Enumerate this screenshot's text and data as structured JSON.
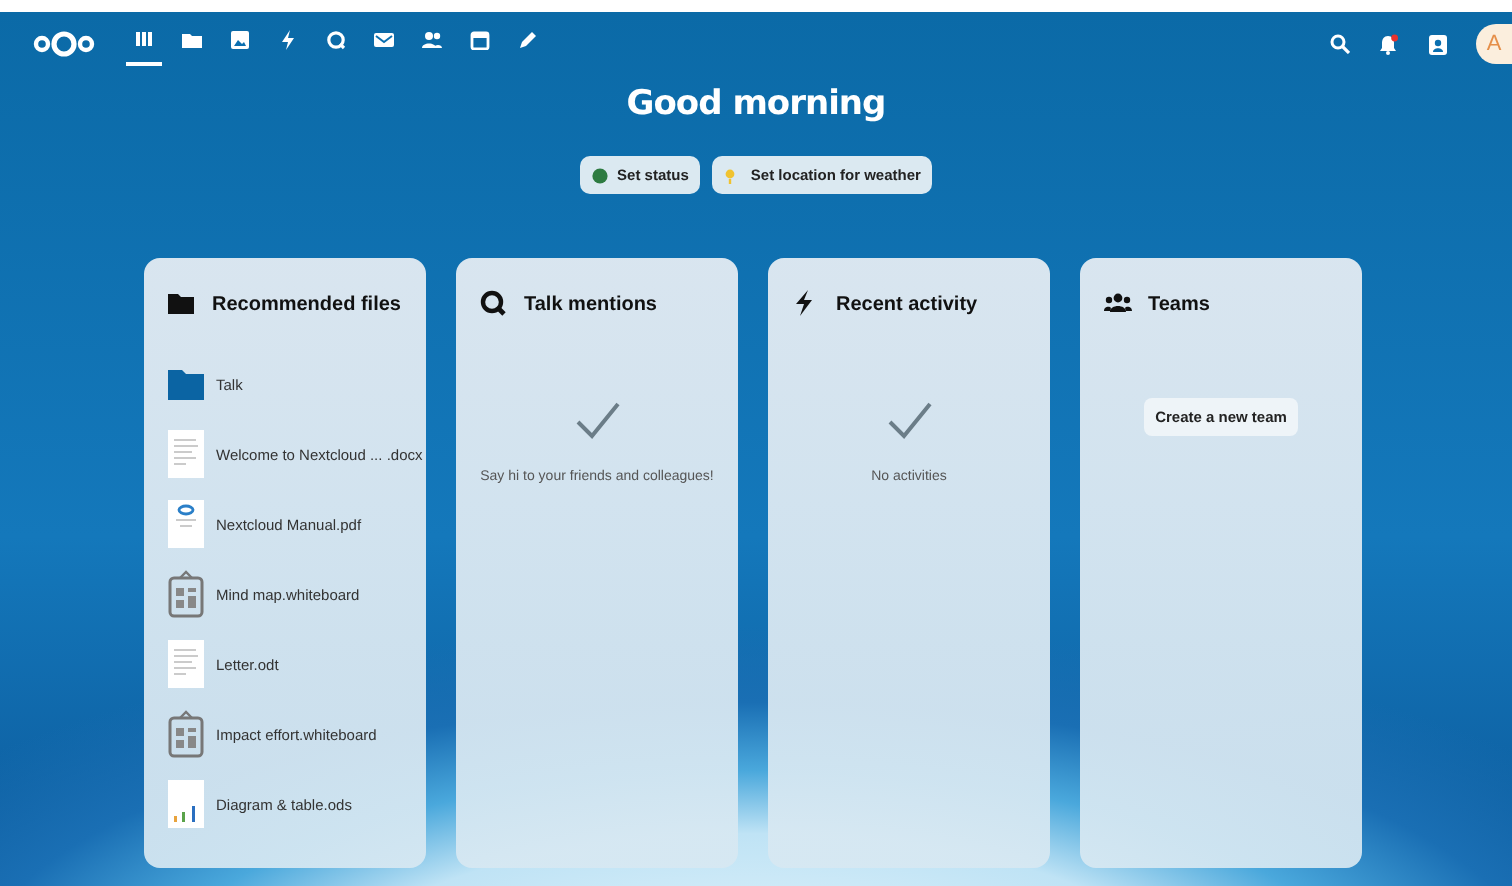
{
  "header": {
    "apps": [
      {
        "selected": true
      },
      {
        "selected": false
      },
      {
        "selected": false
      },
      {
        "selected": false
      },
      {
        "selected": false
      },
      {
        "selected": false
      },
      {
        "selected": false
      },
      {
        "selected": false
      },
      {
        "selected": false
      }
    ],
    "notifications": {
      "unread": true
    },
    "avatar": "A"
  },
  "greeting": "Good morning",
  "actions": [
    {
      "label": "Set status",
      "kind": "status"
    },
    {
      "label": "Set location for weather",
      "kind": "weather"
    }
  ],
  "widgets": [
    {
      "kind": "files",
      "title": "Recommended files",
      "items": [
        {
          "kind": "folder",
          "name": "Talk"
        },
        {
          "kind": "document",
          "name": "Welcome to Nextcloud ... .docx"
        },
        {
          "kind": "pdf",
          "name": "Nextcloud Manual.pdf"
        },
        {
          "kind": "whiteboard",
          "name": "Mind map.whiteboard"
        },
        {
          "kind": "document",
          "name": "Letter.odt"
        },
        {
          "kind": "whiteboard",
          "name": "Impact effort.whiteboard"
        },
        {
          "kind": "spreadsheet",
          "name": "Diagram & table.ods"
        }
      ]
    },
    {
      "kind": "empty",
      "title": "Talk mentions",
      "message": "Say hi to your friends and colleagues!"
    },
    {
      "kind": "empty",
      "title": "Recent activity",
      "message": "No activities"
    },
    {
      "kind": "teams",
      "title": "Teams",
      "button": "Create a new team"
    }
  ]
}
